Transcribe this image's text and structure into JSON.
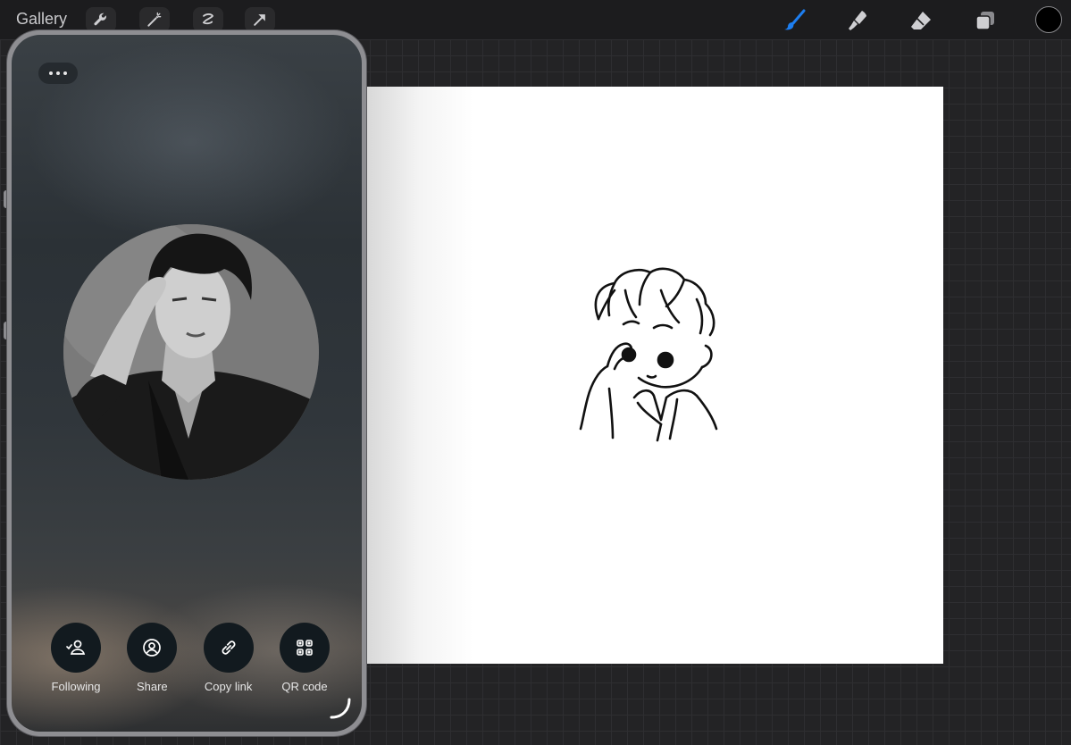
{
  "topbar": {
    "gallery_label": "Gallery",
    "left_tools": [
      "wrench-icon",
      "magic-wand-icon",
      "selection-icon",
      "transform-arrow-icon"
    ],
    "right_tools": [
      "brush-icon",
      "smudge-icon",
      "eraser-icon",
      "layers-icon"
    ],
    "active_tool": "brush",
    "current_color": "#000000"
  },
  "overlay": {
    "more_icon": "ellipsis-icon",
    "actions": [
      {
        "label": "Following",
        "icon": "person-check-icon"
      },
      {
        "label": "Share",
        "icon": "person-circle-icon"
      },
      {
        "label": "Copy link",
        "icon": "link-icon"
      },
      {
        "label": "QR code",
        "icon": "qr-code-icon"
      }
    ]
  },
  "colors": {
    "accent": "#1d7ef0",
    "toolbar_bg": "#1c1c1e",
    "canvas_bg": "#ffffff",
    "action_button_bg": "#121a1f"
  }
}
